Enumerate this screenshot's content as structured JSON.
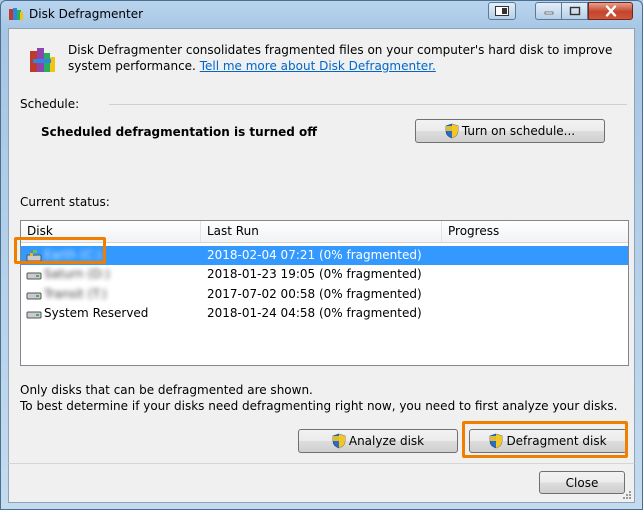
{
  "window": {
    "title": "Disk Defragmenter"
  },
  "intro": {
    "text": "Disk Defragmenter consolidates fragmented files on your computer's hard disk to improve system performance.",
    "link": "Tell me more about Disk Defragmenter."
  },
  "schedule": {
    "label": "Schedule:",
    "status": "Scheduled defragmentation is turned off",
    "button_label": "Turn on schedule..."
  },
  "current_status": {
    "label": "Current status:",
    "columns": [
      "Disk",
      "Last Run",
      "Progress"
    ],
    "rows": [
      {
        "disk": "Earth (C:)",
        "last_run": "2018-02-04 07:21 (0% fragmented)",
        "progress": "",
        "selected": true,
        "blurred": true,
        "icon": "system-drive-icon"
      },
      {
        "disk": "Saturn (D:)",
        "last_run": "2018-01-23 19:05 (0% fragmented)",
        "progress": "",
        "selected": false,
        "blurred": true,
        "icon": "hard-drive-icon"
      },
      {
        "disk": "Transit (T:)",
        "last_run": "2017-07-02 00:58 (0% fragmented)",
        "progress": "",
        "selected": false,
        "blurred": true,
        "icon": "hard-drive-icon"
      },
      {
        "disk": "System Reserved",
        "last_run": "2018-01-24 04:58 (0% fragmented)",
        "progress": "",
        "selected": false,
        "blurred": false,
        "icon": "hard-drive-icon"
      }
    ]
  },
  "notes": {
    "line1": "Only disks that can be defragmented are shown.",
    "line2": "To best determine if your disks need defragmenting right now, you need to first analyze your disks."
  },
  "actions": {
    "analyze_label": "Analyze disk",
    "defragment_label": "Defragment disk",
    "close_label": "Close"
  },
  "colors": {
    "selection": "#3399ff",
    "highlight": "#f07f00",
    "link": "#0066cc"
  }
}
